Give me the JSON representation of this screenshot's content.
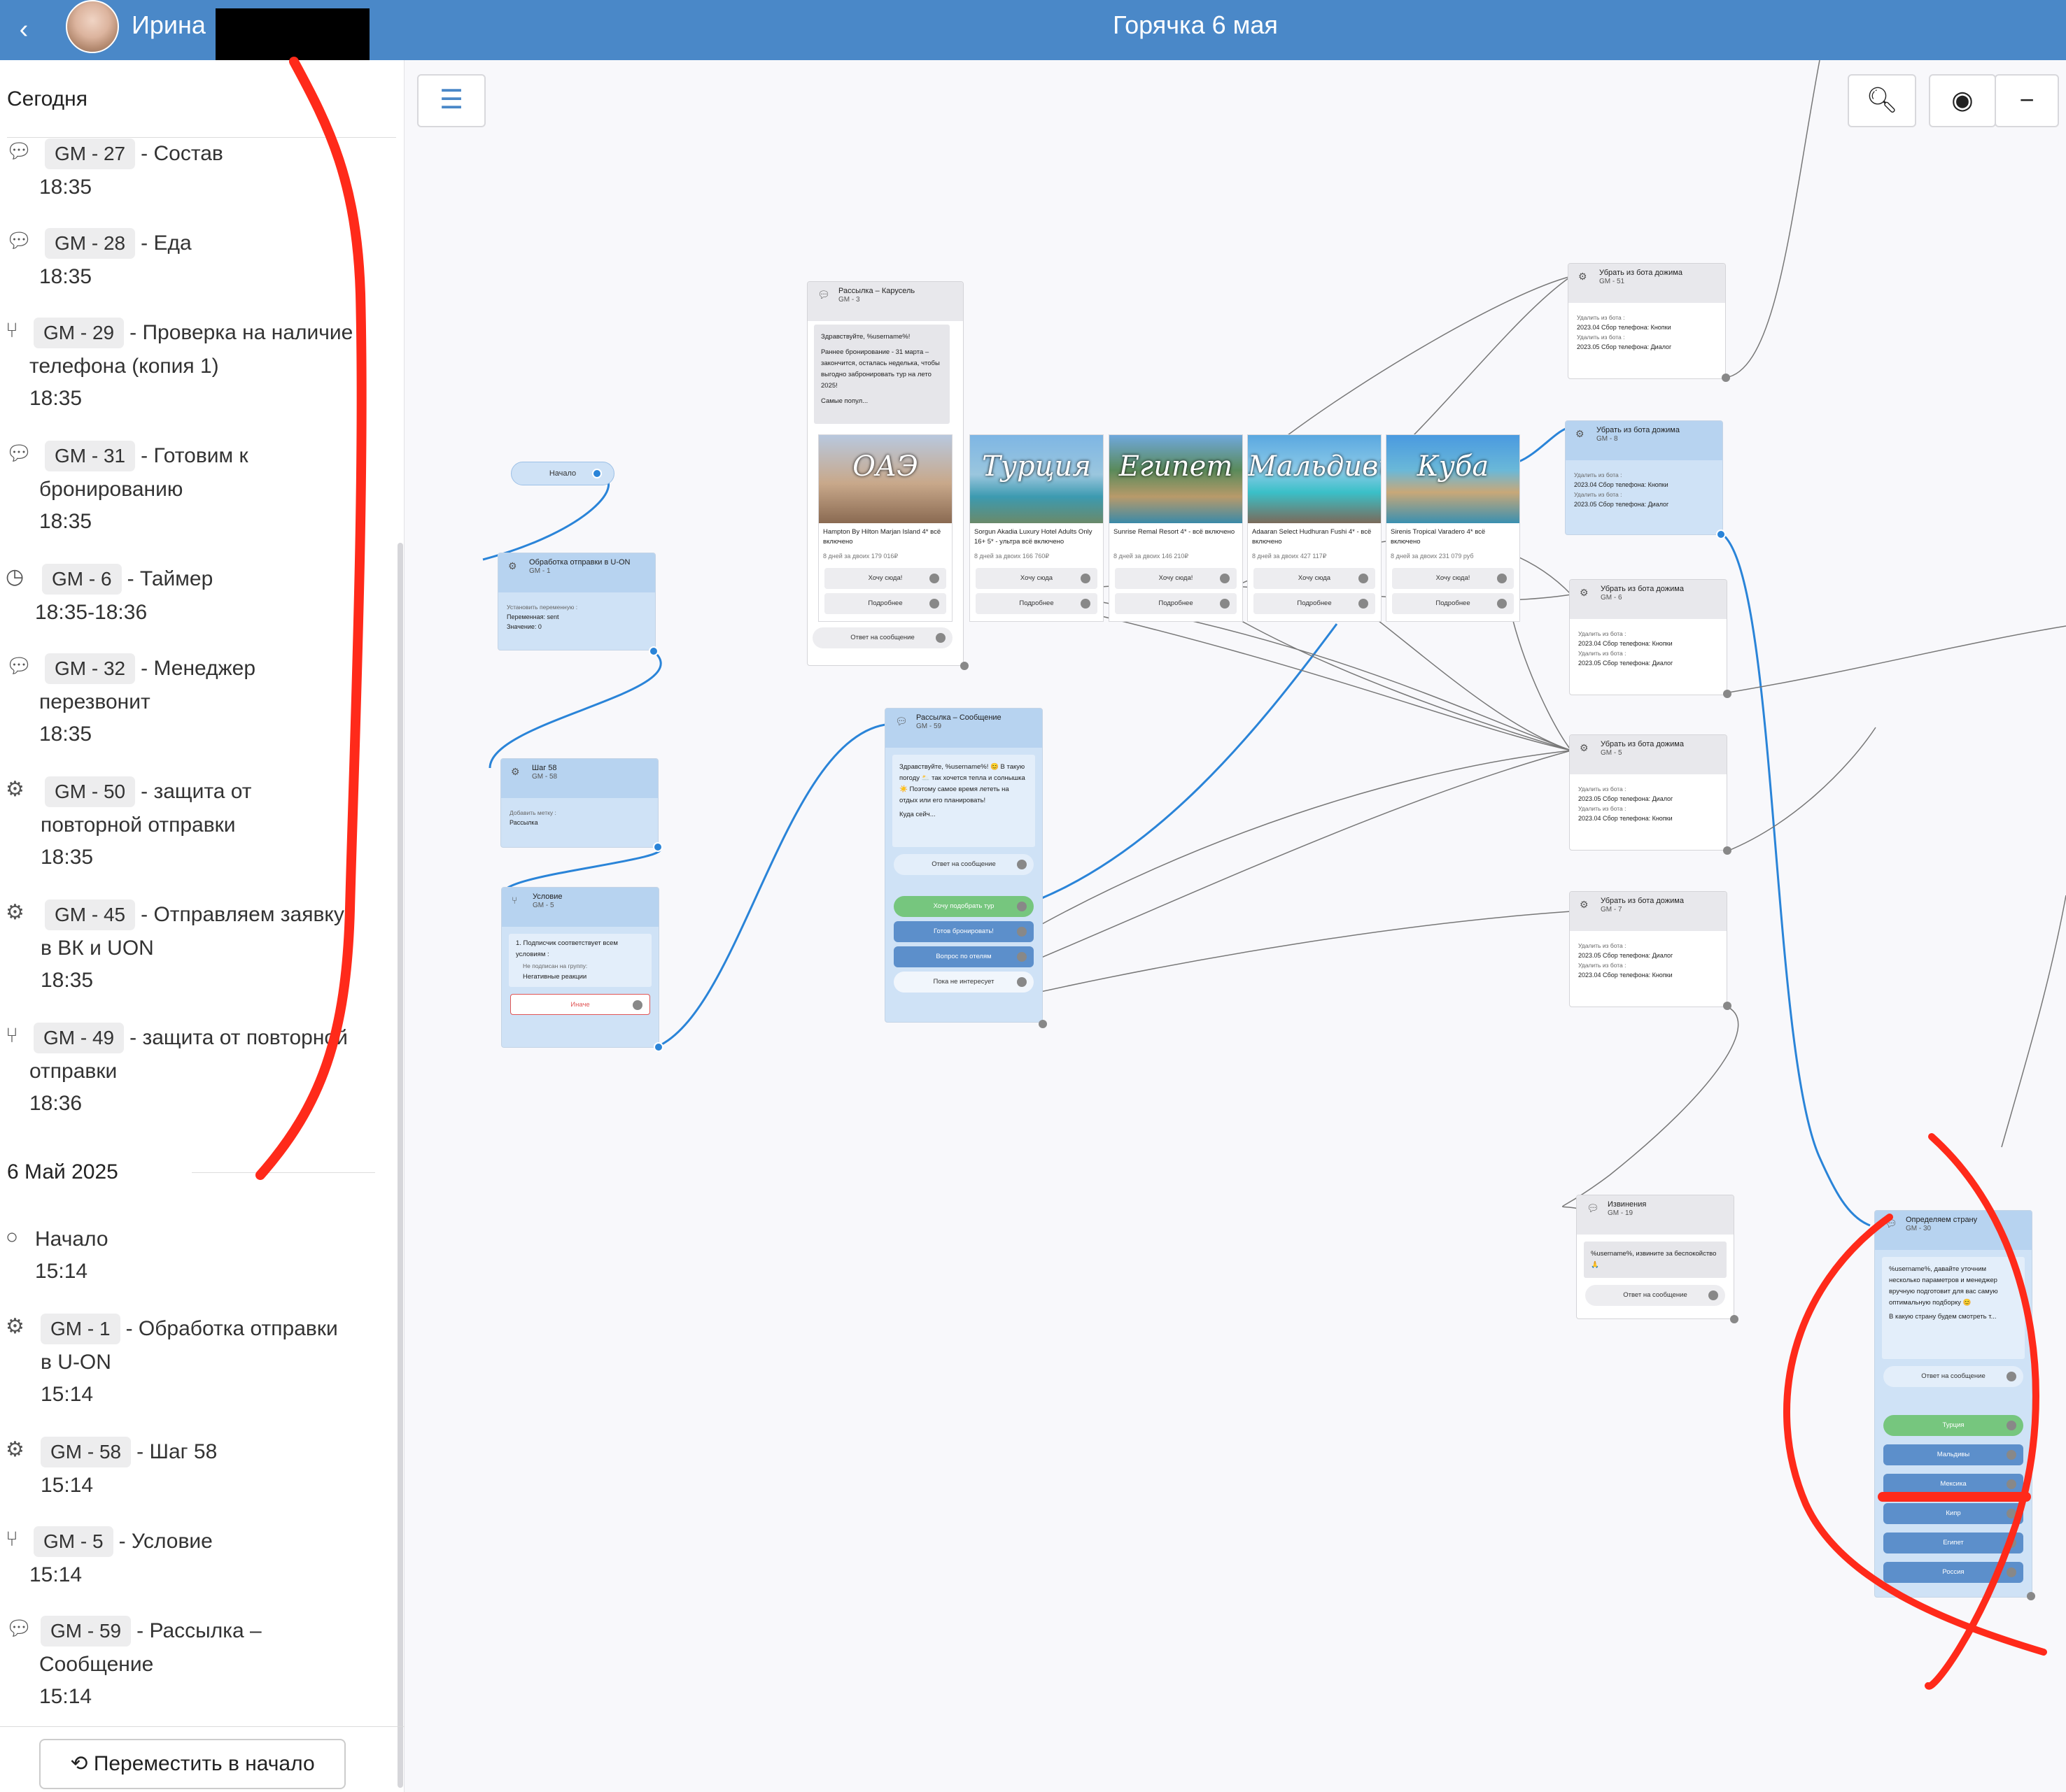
{
  "header": {
    "back_icon": "chevron-left-icon",
    "user_name": "Ирина",
    "title": "Горячка 6 мая"
  },
  "sidebar": {
    "group_today": "Сегодня",
    "group_may": "6 Май 2025",
    "events": [
      {
        "icon": "chat-bubble-icon",
        "code": "GM - 27",
        "name": "- Состав",
        "time": "18:35"
      },
      {
        "icon": "chat-bubble-icon",
        "code": "GM - 28",
        "name": "- Еда",
        "time": "18:35"
      },
      {
        "icon": "branch-icon",
        "code": "GM - 29",
        "name": "- Проверка на наличие",
        "name2": "телефона (копия 1)",
        "time": "18:35"
      },
      {
        "icon": "chat-bubble-icon",
        "code": "GM - 31",
        "name": "- Готовим к",
        "name2": "бронированию",
        "time": "18:35"
      },
      {
        "icon": "clock-icon",
        "code": "GM - 6",
        "name": "- Таймер",
        "time": "18:35-18:36"
      },
      {
        "icon": "chat-bubble-icon",
        "code": "GM - 32",
        "name": "- Менеджер",
        "name2": "перезвонит",
        "time": "18:35"
      },
      {
        "icon": "gears-icon",
        "code": "GM - 50",
        "name": "- защита от",
        "name2": "повторной отправки",
        "time": "18:35"
      },
      {
        "icon": "gears-icon",
        "code": "GM - 45",
        "name": "- Отправляем заявку",
        "name2": "в ВК и UON",
        "time": "18:35"
      },
      {
        "icon": "branch-icon",
        "code": "GM - 49",
        "name": "- защита от повторной",
        "name2": "отправки",
        "time": "18:36"
      },
      {
        "icon": "circle-icon",
        "code": "",
        "name": "Начало",
        "time": "15:14"
      },
      {
        "icon": "gears-icon",
        "code": "GM - 1",
        "name": "- Обработка отправки",
        "name2": "в U-ON",
        "time": "15:14"
      },
      {
        "icon": "gears-icon",
        "code": "GM - 58",
        "name": "- Шаг 58",
        "time": "15:14"
      },
      {
        "icon": "branch-icon",
        "code": "GM - 5",
        "name": "- Условие",
        "time": "15:14"
      },
      {
        "icon": "chat-bubble-icon",
        "code": "GM - 59",
        "name": "- Рассылка –",
        "name2": "Сообщение",
        "time": "15:14"
      }
    ],
    "move_button": "Переместить в начало"
  },
  "toolbar": {
    "list_icon": "list-icon",
    "search_icon": "search-icon",
    "target_icon": "target-icon",
    "zoom_out_icon": "minus-icon"
  },
  "nodes": {
    "start": {
      "label": "Начало"
    },
    "gm1": {
      "title": "Обработка отправки в U-ON",
      "code": "GM - 1",
      "lbl1": "Установить переменную :",
      "v1": "Переменная: sent",
      "v2": "Значение: 0"
    },
    "gm58": {
      "title": "Шаг 58",
      "code": "GM - 58",
      "lbl1": "Добавить метку :",
      "v1": "Рассылка"
    },
    "gm5": {
      "title": "Условие",
      "code": "GM - 5",
      "cond": "1. Подписчик соответствует всем условиям :",
      "sub1": "Не подписан на группу:",
      "sub2": "Негативные реакции",
      "else": "Иначе"
    },
    "gm3": {
      "title": "Рассылка – Карусель",
      "code": "GM - 3",
      "text1": "Здравствуйте, %username%!",
      "text2": "Раннее бронирование - 31 марта – закончится, осталась неделька, чтобы выгодно забронировать тур на лето 2025!",
      "text3": "Самые попул...",
      "reply": "Ответ на сообщение"
    },
    "cards": [
      {
        "cap": "ОАЭ",
        "name": "Hampton By Hilton Marjan Island 4* всё включено",
        "price": "8 дней за двоих 179 016₽",
        "b1": "Хочу сюда!",
        "b2": "Подробнее"
      },
      {
        "cap": "Турция",
        "name": "Sorgun Akadia Luxury Hotel Adults Only 16+ 5* - ультра всё включено",
        "price": "8 дней за двоих 166 760₽",
        "b1": "Хочу сюда",
        "b2": "Подробнее"
      },
      {
        "cap": "Египет",
        "name": "Sunrise Remal Resort 4* - всё включено",
        "price": "8 дней за двоих 146 210₽",
        "b1": "Хочу сюда!",
        "b2": "Подробнее"
      },
      {
        "cap": "Мальдивы",
        "name": "Adaaran Select Hudhuran Fushi 4* - всё включено",
        "price": "8 дней за двоих 427 117₽",
        "b1": "Хочу сюда",
        "b2": "Подробнее"
      },
      {
        "cap": "Куба",
        "name": "Sirenis Tropical Varadero 4* всё включено",
        "price": "8 дней за двоих 231 079 руб",
        "b1": "Хочу сюда!",
        "b2": "Подробнее"
      }
    ],
    "gm59": {
      "title": "Рассылка – Сообщение",
      "code": "GM - 59",
      "text1": "Здравствуйте, %username%! 😊 В такую погоду 🌥️ так хочется тепла и солнышка ☀️ Поэтому самое время лететь на отдых или его планировать!",
      "text2": "Куда сейч...",
      "reply": "Ответ на сообщение",
      "btn1": "Хочу подобрать тур",
      "btn2": "Готов бронировать!",
      "btn3": "Вопрос по отелям",
      "btn4": "Пока не интересует"
    },
    "gm51": {
      "title": "Убрать из бота дожима",
      "code": "GM - 51",
      "l1": "Удалить из бота :",
      "v1": "2023.04 Сбор телефона: Кнопки",
      "l2": "Удалить из бота :",
      "v2": "2023.05 Сбор телефона: Диалог"
    },
    "gm8": {
      "title": "Убрать из бота дожима",
      "code": "GM - 8",
      "l1": "Удалить из бота :",
      "v1": "2023.04 Сбор телефона: Кнопки",
      "l2": "Удалить из бота :",
      "v2": "2023.05 Сбор телефона: Диалог"
    },
    "gm6": {
      "title": "Убрать из бота дожима",
      "code": "GM - 6",
      "l1": "Удалить из бота :",
      "v1": "2023.04 Сбор телефона: Кнопки",
      "l2": "Удалить из бота :",
      "v2": "2023.05 Сбор телефона: Диалог"
    },
    "gm5b": {
      "title": "Убрать из бота дожима",
      "code": "GM - 5",
      "l1": "Удалить из бота :",
      "v1": "2023.05 Сбор телефона: Диалог",
      "l2": "Удалить из бота :",
      "v2": "2023.04 Сбор телефона: Кнопки"
    },
    "gm7": {
      "title": "Убрать из бота дожима",
      "code": "GM - 7",
      "l1": "Удалить из бота :",
      "v1": "2023.05 Сбор телефона: Диалог",
      "l2": "Удалить из бота :",
      "v2": "2023.04 Сбор телефона: Кнопки"
    },
    "gm19": {
      "title": "Извинения",
      "code": "GM - 19",
      "text": "%username%, извините за беспокойство🙏",
      "reply": "Ответ на сообщение"
    },
    "gm30": {
      "title": "Определяем страну",
      "code": "GM - 30",
      "text1": "%username%, давайте уточним несколько параметров и менеджер вручную подготовит для вас самую оптимальную подборку 😊",
      "text2": "В какую страну будем смотреть т...",
      "reply": "Ответ на сообщение",
      "buttons": [
        "Турция",
        "Мальдивы",
        "Мексика",
        "Кипр",
        "Египет",
        "Россия"
      ]
    }
  },
  "colors": {
    "header": "#4a88c8",
    "wire_blue": "#2a84d8",
    "wire_gray": "#777777",
    "annotation_red": "#ff2a1a",
    "green_button": "#76c67e",
    "blue_button": "#5c8fcb"
  }
}
